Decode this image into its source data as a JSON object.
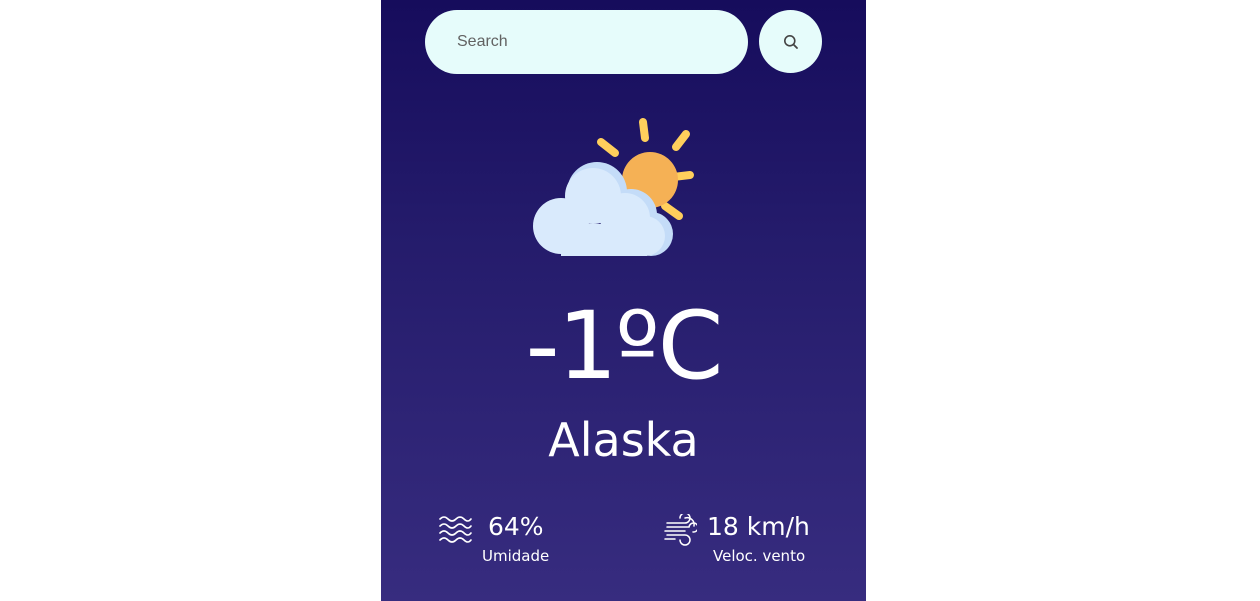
{
  "search": {
    "placeholder": "Search",
    "value": "",
    "button_icon": "search-icon"
  },
  "weather": {
    "icon": "partly-cloudy-icon",
    "temperature": "-1ºC",
    "city": "Alaska"
  },
  "details": {
    "humidity": {
      "icon": "humidity-waves-icon",
      "value": "64%",
      "label": "Umidade"
    },
    "wind": {
      "icon": "wind-icon",
      "value": "18 km/h",
      "label": "Veloc. vento"
    }
  },
  "colors": {
    "background_top": "#160c5c",
    "background_bottom": "#372c7f",
    "search_background": "#e6fcfb",
    "sun": "#f5b155",
    "sun_rays": "#ffcf5c",
    "cloud": "#d9eafc",
    "text": "#ffffff"
  }
}
